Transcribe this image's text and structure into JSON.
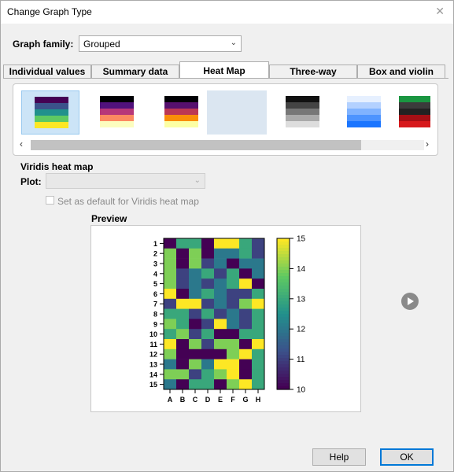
{
  "window": {
    "title": "Change Graph Type",
    "close_glyph": "✕"
  },
  "graph_family": {
    "label": "Graph family:",
    "value": "Grouped"
  },
  "tabs": [
    {
      "label": "Individual values"
    },
    {
      "label": "Summary data"
    },
    {
      "label": "Heat Map",
      "active": true
    },
    {
      "label": "Three-way"
    },
    {
      "label": "Box and violin"
    }
  ],
  "gallery": {
    "thumbnails": [
      {
        "name": "viridis",
        "colors": [
          "#440154",
          "#3b528b",
          "#21918c",
          "#5ec962",
          "#fde725"
        ]
      },
      {
        "name": "magma",
        "colors": [
          "#000004",
          "#51127c",
          "#b73779",
          "#fc8961",
          "#fcfdbf"
        ]
      },
      {
        "name": "inferno",
        "colors": [
          "#000004",
          "#56106e",
          "#bb3754",
          "#f98e09",
          "#fcffa4"
        ]
      },
      {
        "name": "blank",
        "colors": []
      },
      {
        "name": "grayscale",
        "colors": [
          "#111111",
          "#444444",
          "#777777",
          "#aaaaaa",
          "#dddddd"
        ]
      },
      {
        "name": "blues",
        "colors": [
          "#e6f0ff",
          "#b3d1ff",
          "#80b3ff",
          "#4d94ff",
          "#1a75ff"
        ]
      },
      {
        "name": "green-red",
        "colors": [
          "#1a9641",
          "#3b3b3b",
          "#222222",
          "#a50f15",
          "#d7191c"
        ]
      }
    ]
  },
  "heatmap_section": {
    "title": "Viridis heat map",
    "plot_label": "Plot:",
    "default_checkbox_label": "Set as default for Viridis heat map"
  },
  "preview": {
    "title": "Preview",
    "columns": [
      "A",
      "B",
      "C",
      "D",
      "E",
      "F",
      "G",
      "H"
    ],
    "rows": [
      "1",
      "2",
      "3",
      "4",
      "5",
      "6",
      "7",
      "8",
      "9",
      "10",
      "11",
      "12",
      "13",
      "14",
      "15"
    ],
    "colorbar_ticks": [
      "15",
      "14",
      "13",
      "12",
      "11",
      "10"
    ],
    "vmin": 10,
    "vmax": 15,
    "values": [
      [
        10,
        13,
        13,
        10,
        15,
        15,
        13,
        11
      ],
      [
        14,
        10,
        14,
        10,
        12,
        12,
        13,
        11
      ],
      [
        14,
        10,
        14,
        11,
        12,
        10,
        12,
        12
      ],
      [
        14,
        11,
        12,
        13,
        11,
        13,
        10,
        12
      ],
      [
        14,
        11,
        12,
        11,
        12,
        13,
        15,
        10
      ],
      [
        15,
        10,
        12,
        13,
        12,
        11,
        11,
        13
      ],
      [
        11,
        15,
        15,
        11,
        12,
        11,
        14,
        15
      ],
      [
        13,
        13,
        11,
        13,
        11,
        12,
        11,
        13
      ],
      [
        14,
        13,
        10,
        11,
        15,
        12,
        11,
        13
      ],
      [
        13,
        14,
        11,
        13,
        10,
        10,
        13,
        13
      ],
      [
        15,
        10,
        14,
        11,
        14,
        14,
        10,
        15
      ],
      [
        14,
        10,
        10,
        10,
        10,
        14,
        15,
        13
      ],
      [
        12,
        10,
        14,
        12,
        15,
        15,
        10,
        13
      ],
      [
        14,
        14,
        11,
        13,
        14,
        15,
        10,
        13
      ],
      [
        12,
        10,
        13,
        13,
        10,
        14,
        15,
        13
      ]
    ]
  },
  "buttons": {
    "help": "Help",
    "ok": "OK"
  }
}
